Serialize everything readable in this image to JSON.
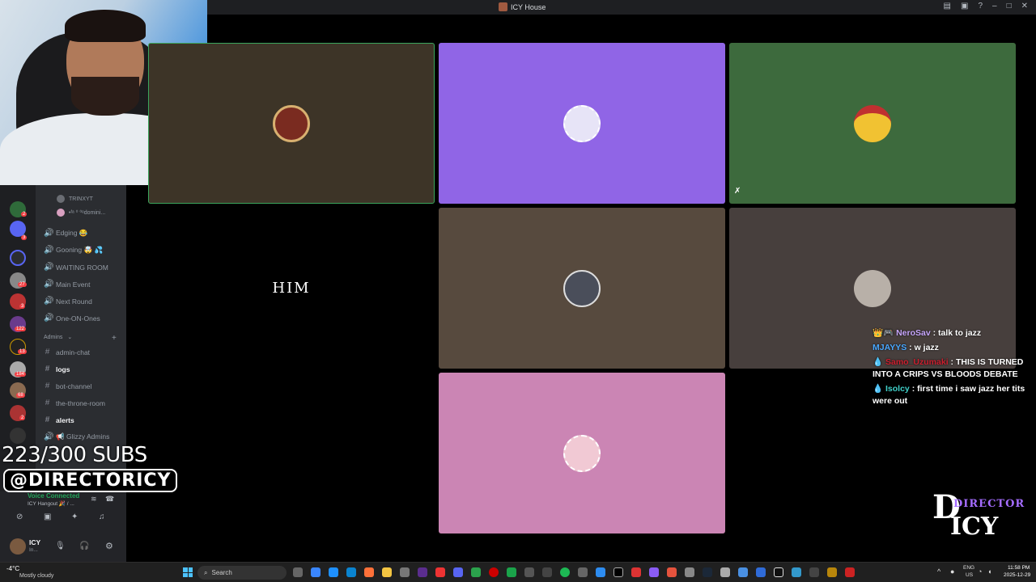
{
  "window": {
    "title": "ICY House"
  },
  "overlay": {
    "subs_text": "223/300 SUBS",
    "handle_text": "@DIRECTORICY",
    "logo_lines": [
      "DIRECTOR",
      "ICY"
    ]
  },
  "voice_users": [
    "TRINXYT",
    "•ᶠᵃ ⁰ ⁰ᵉdomini..."
  ],
  "channels": {
    "voice": [
      "Edging 😂",
      "Gooning 🤯 💦",
      "WAITING ROOM",
      "Main Event",
      "Next Round",
      "One-ON-Ones"
    ],
    "admins_label": "Admins",
    "text": [
      {
        "name": "admin-chat",
        "bold": false
      },
      {
        "name": "logs",
        "bold": true
      },
      {
        "name": "bot-channel",
        "bold": false
      },
      {
        "name": "the-throne-room",
        "bold": false
      },
      {
        "name": "alerts",
        "bold": true
      }
    ],
    "extra_voice": "📢 Glizzy Admins"
  },
  "server_badges": [
    "2",
    "3",
    "27",
    "3",
    "122",
    "13",
    "184",
    "68",
    "2"
  ],
  "voice_panel": {
    "status": "Voice Connected",
    "location": "ICY Hangout 🎉 / ..."
  },
  "user_panel": {
    "username": "ICY",
    "status": "In..."
  },
  "tiles": [
    {
      "label": "",
      "color": "#3d3427",
      "avatar_color": "#7a2b20"
    },
    {
      "label": "",
      "color": "#9065e6",
      "avatar_color": "#e7e4f7"
    },
    {
      "label": "",
      "color": "#3d6a3d",
      "avatar_color": "#f1c232"
    },
    {
      "label": "HIM",
      "color": "#000000",
      "avatar_color": ""
    },
    {
      "label": "",
      "color": "#574a3e",
      "avatar_color": "#556"
    },
    {
      "label": "",
      "color": "#473f3d",
      "avatar_color": "#ccc"
    },
    {
      "label": "",
      "color": "#cb85b4",
      "avatar_color": "#f1c9d4"
    }
  ],
  "chat": [
    {
      "user": "NeroSav",
      "user_color": "#c9a8ff",
      "badge": "👑🎮",
      "message": "talk to jazz"
    },
    {
      "user": "MJAYYS",
      "user_color": "#4aa8ff",
      "badge": "",
      "message": "w jazz"
    },
    {
      "user": "Samo_Uzumaki",
      "user_color": "#cc1f2f",
      "badge": "💧",
      "message": "THIS IS TURNED INTO A CRIPS VS BLOODS DEBATE"
    },
    {
      "user": "Isolcy",
      "user_color": "#3fd0c9",
      "badge": "💧",
      "message": "first time i saw jazz her tits were out"
    }
  ],
  "taskbar": {
    "search_placeholder": "Search",
    "weather": "-4°C",
    "weather_desc": "Mostly cloudy",
    "lang": "ENG",
    "region": "US",
    "time": "11:58 PM",
    "date": "2025-12-29"
  }
}
